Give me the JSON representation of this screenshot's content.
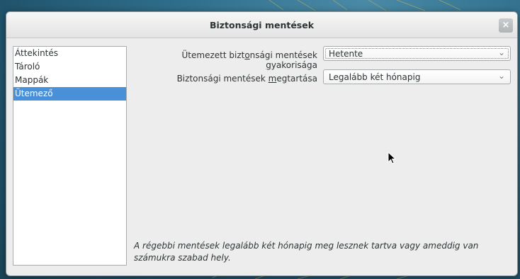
{
  "window": {
    "title": "Biztonsági mentések",
    "close_icon": "close-icon"
  },
  "sidebar": {
    "items": [
      {
        "label": "Áttekintés",
        "selected": false
      },
      {
        "label": "Tároló",
        "selected": false
      },
      {
        "label": "Mappák",
        "selected": false
      },
      {
        "label": "Ütemező",
        "selected": true
      }
    ]
  },
  "settings": {
    "frequency": {
      "label_pre": "Ütemezett bizt",
      "label_accel": "o",
      "label_mid": "nsági mentések ",
      "label_accel2": "g",
      "label_post": "yakorisága",
      "value": "Hetente"
    },
    "retention": {
      "label_pre": "Biztonsági mentések ",
      "label_accel": "m",
      "label_post": "egtartása",
      "value": "Legalább két hónapig"
    }
  },
  "note": "A régebbi mentések legalább két hónapig meg lesznek tartva vagy ameddig van számukra szabad hely.",
  "colors": {
    "selection": "#4a90d9",
    "desktop": "#2f6f8c"
  }
}
